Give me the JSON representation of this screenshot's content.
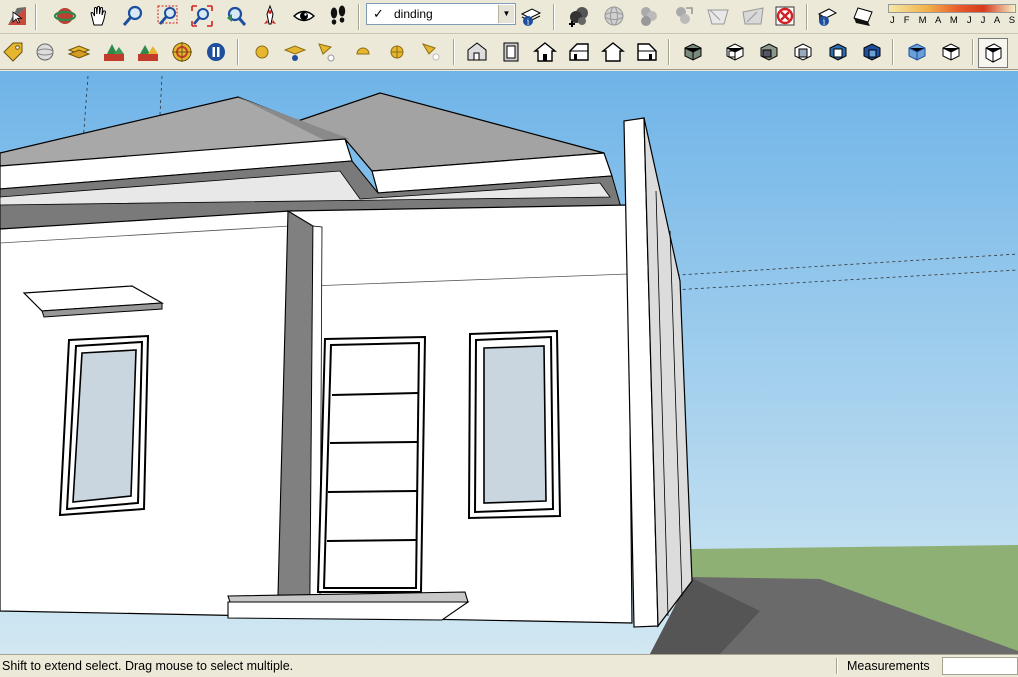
{
  "toolbar": {
    "row1": [
      {
        "name": "select-tool",
        "icon": "select-arrow-icon"
      },
      {
        "name": "orbit-tool",
        "icon": "orbit-icon"
      },
      {
        "name": "pan-tool",
        "icon": "hand-icon"
      },
      {
        "name": "zoom-tool",
        "icon": "magnifier-icon"
      },
      {
        "name": "zoom-window-tool",
        "icon": "zoom-window-icon"
      },
      {
        "name": "zoom-extents-tool",
        "icon": "zoom-extents-icon"
      },
      {
        "name": "previous-view-tool",
        "icon": "previous-view-icon"
      },
      {
        "name": "position-camera-tool",
        "icon": "camera-icon"
      },
      {
        "name": "look-around-tool",
        "icon": "eye-icon"
      },
      {
        "name": "walk-tool",
        "icon": "footprints-icon"
      }
    ],
    "layers": {
      "current": "dinding",
      "check": "✓",
      "dropdown": "▼"
    },
    "row1_right": [
      {
        "name": "layer-manager",
        "icon": "layer-manager-icon"
      },
      {
        "name": "add-location",
        "icon": "add-location-icon"
      },
      {
        "name": "toggle-terrain",
        "icon": "terrain-icon"
      },
      {
        "name": "get-models",
        "icon": "get-models-icon"
      },
      {
        "name": "share-model",
        "icon": "share-model-icon"
      },
      {
        "name": "share-component",
        "icon": "share-component-icon"
      },
      {
        "name": "photo-textures",
        "icon": "photo-textures-icon"
      },
      {
        "name": "extension-warehouse",
        "icon": "extension-icon"
      },
      {
        "name": "shadow-settings",
        "icon": "shadow-settings-icon"
      },
      {
        "name": "display-shadows",
        "icon": "display-shadows-icon"
      }
    ],
    "months": "J F M A M J J A S O N"
  },
  "status": {
    "text": "Shift to extend select. Drag mouse to select multiple.",
    "measurements_label": "Measurements",
    "measurements_value": ""
  },
  "colors": {
    "sky_top": "#6fb4e8",
    "sky_bottom": "#d2e8f2",
    "ground": "#8fb075",
    "wall": "#ffffff",
    "roof": "#a9a9a9",
    "shade": "#808080",
    "glass": "#c9d6e0"
  }
}
